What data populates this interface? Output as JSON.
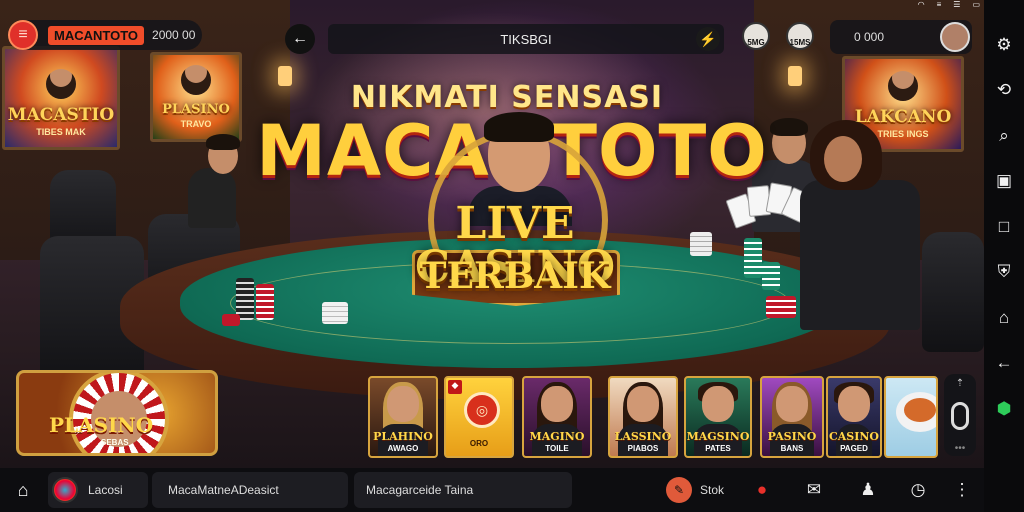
{
  "status_bar": {
    "wifi_icon": "wifi-icon",
    "menu_icon": "hamburger-icon",
    "battery_icon": "battery-icon"
  },
  "header": {
    "brand": {
      "menu_icon": "hamburger-icon",
      "name": "MACANTOTO",
      "value": "2000 00"
    },
    "back_icon": "arrow-left-icon",
    "title": "TIKSBGI",
    "title_icon": "lightning-icon",
    "quick_avatars": [
      "5MG",
      "15MS"
    ],
    "account": {
      "value": "0 000",
      "avatar_icon": "user-avatar"
    }
  },
  "hero": {
    "line1": "NIKMATI SENSASI",
    "line2": "MACANTOTO",
    "badge_main": "LIVE CASINO",
    "badge_sub": "TERBAIK"
  },
  "background_posters": [
    {
      "title": "MACASTIO",
      "sub": "TIBES MAK"
    },
    {
      "title": "PLASINO",
      "sub": "TRAVO"
    },
    {
      "title": "LAKCANO",
      "sub": "TRIES INGS"
    }
  ],
  "tiles": {
    "featured": {
      "title": "PLASINO",
      "sub": "SEBAS"
    },
    "items": [
      {
        "title": "PLAHINO",
        "sub": "AWAGO",
        "kind": "person"
      },
      {
        "title": "",
        "sub": "ORO",
        "kind": "chip"
      },
      {
        "title": "MAGINO",
        "sub": "TOILE",
        "kind": "person"
      },
      {
        "title": "LASSINO",
        "sub": "PIABOS",
        "kind": "person"
      },
      {
        "title": "MAGSINO",
        "sub": "PATES",
        "kind": "person"
      },
      {
        "title": "PASINO",
        "sub": "BANS",
        "kind": "person"
      },
      {
        "title": "CASINO",
        "sub": "PAGED",
        "kind": "person"
      },
      {
        "title": "",
        "sub": "",
        "kind": "food"
      }
    ],
    "scroll": {
      "up_icon": "chevrons-icon",
      "knob_value": "0",
      "more_icon": "dots-icon"
    }
  },
  "side_nav": [
    {
      "icon": "settings-gear-icon"
    },
    {
      "icon": "link-icon"
    },
    {
      "icon": "search-icon"
    },
    {
      "icon": "wallet-icon"
    },
    {
      "icon": "square-icon"
    },
    {
      "icon": "shield-icon"
    },
    {
      "icon": "home-icon"
    },
    {
      "icon": "back-arrow-icon"
    },
    {
      "icon": "android-icon"
    }
  ],
  "bottom_bar": {
    "home_icon": "home-icon",
    "segment1": "Lacosi",
    "segment2": "MacaMatneADeasict",
    "segment3": "Macagarceide Taina",
    "stok_label": "Stok",
    "icons": [
      "gift-icon",
      "chat-icon",
      "notification-icon",
      "clock-icon",
      "more-icon"
    ]
  },
  "colors": {
    "accent": "#f04d2a",
    "gold": "#ffd84a",
    "felt": "#1f8e72",
    "sidebar": "#0a0a0c"
  }
}
